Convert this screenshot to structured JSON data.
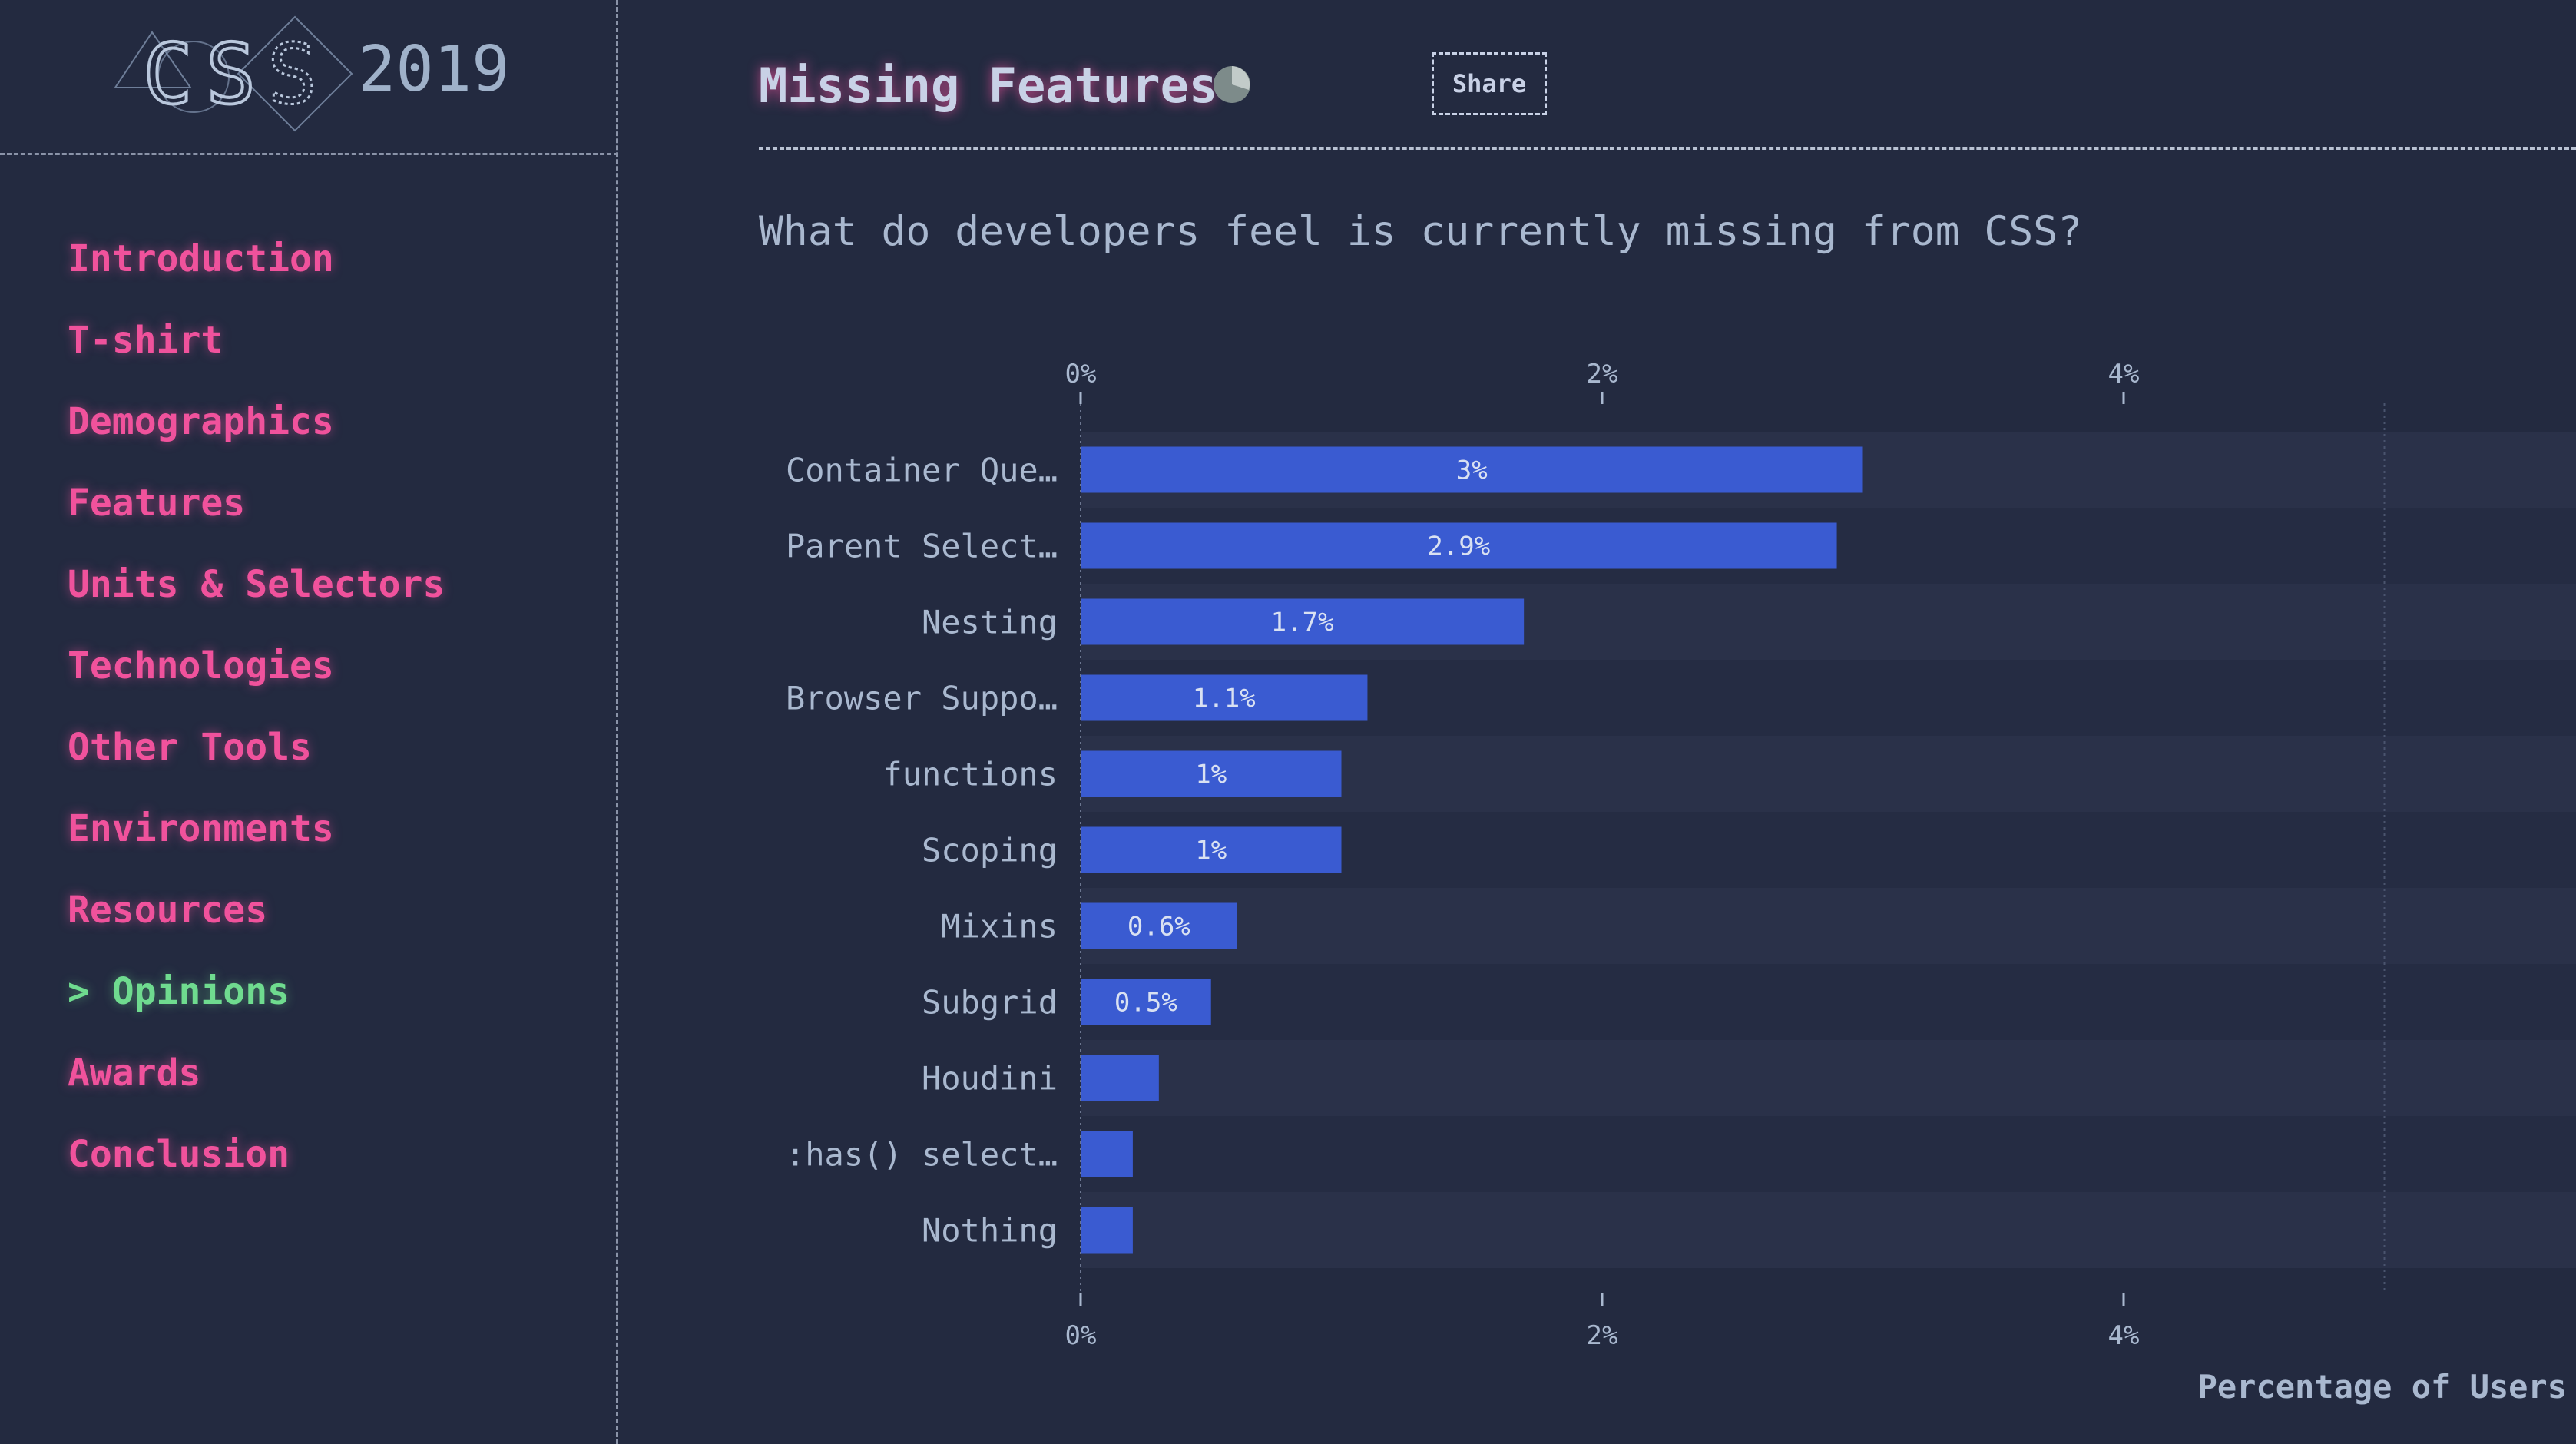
{
  "logo": {
    "letters": [
      "C",
      "S",
      "S"
    ],
    "year": "2019"
  },
  "nav": {
    "items": [
      {
        "label": "Introduction",
        "name": "nav-item-introduction"
      },
      {
        "label": "T-shirt",
        "name": "nav-item-t-shirt"
      },
      {
        "label": "Demographics",
        "name": "nav-item-demographics"
      },
      {
        "label": "Features",
        "name": "nav-item-features"
      },
      {
        "label": "Units & Selectors",
        "name": "nav-item-units-selectors"
      },
      {
        "label": "Technologies",
        "name": "nav-item-technologies"
      },
      {
        "label": "Other Tools",
        "name": "nav-item-other-tools"
      },
      {
        "label": "Environments",
        "name": "nav-item-environments"
      },
      {
        "label": "Resources",
        "name": "nav-item-resources"
      },
      {
        "label": "> Opinions",
        "name": "nav-item-opinions",
        "active": true
      },
      {
        "label": "Awards",
        "name": "nav-item-awards"
      },
      {
        "label": "Conclusion",
        "name": "nav-item-conclusion"
      }
    ]
  },
  "header": {
    "title": "Missing Features",
    "share_label": "Share",
    "icon": "pie-chart-icon"
  },
  "colors": {
    "background": "#232a40",
    "bar": "#3a5bd1",
    "nav": "#f0529c",
    "nav_active": "#6fdb8f",
    "text": "#a9b8cf"
  },
  "chart_data": {
    "type": "bar",
    "orientation": "horizontal",
    "title": "What do developers feel is currently missing from CSS?",
    "xlabel": "Percentage of Users",
    "ylabel": "",
    "xlim": [
      0,
      6
    ],
    "ticks": [
      "0%",
      "2%",
      "4%"
    ],
    "tick_values": [
      0,
      2,
      4
    ],
    "grid": false,
    "categories": [
      "Container Que…",
      "Parent Select…",
      "Nesting",
      "Browser Suppo…",
      "functions",
      "Scoping",
      "Mixins",
      "Subgrid",
      "Houdini",
      ":has() select…",
      "Nothing"
    ],
    "values": [
      3.0,
      2.9,
      1.7,
      1.1,
      1.0,
      1.0,
      0.6,
      0.5,
      0.3,
      0.2,
      0.2
    ],
    "data_labels": [
      "3%",
      "2.9%",
      "1.7%",
      "1.1%",
      "1%",
      "1%",
      "0.6%",
      "0.5%",
      "",
      "",
      ""
    ]
  }
}
